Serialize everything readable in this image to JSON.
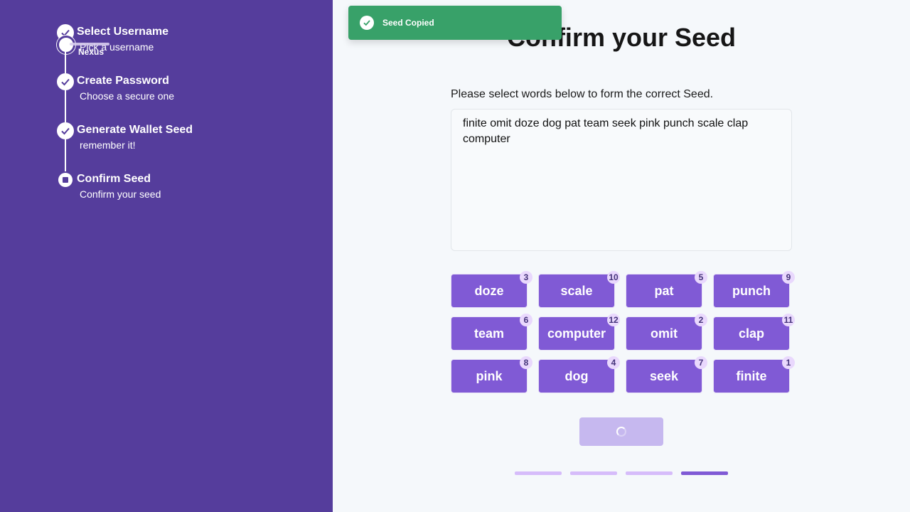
{
  "app": {
    "name": "Nexus"
  },
  "steps": [
    {
      "title": "Select Username",
      "subtitle": "Pick a username",
      "status": "complete"
    },
    {
      "title": "Create Password",
      "subtitle": "Choose a secure one",
      "status": "complete"
    },
    {
      "title": "Generate Wallet Seed",
      "subtitle": "remember it!",
      "status": "complete"
    },
    {
      "title": "Confirm Seed",
      "subtitle": "Confirm your seed",
      "status": "current"
    }
  ],
  "toast": {
    "message": "Seed Copied",
    "icon": "check-icon",
    "color": "#38a169"
  },
  "main": {
    "title": "Confirm your Seed",
    "instructions": "Please select words below to form the correct Seed.",
    "selected_seed": "finite omit doze dog pat team seek pink punch scale clap computer",
    "words": [
      {
        "word": "doze",
        "order": "3"
      },
      {
        "word": "scale",
        "order": "10"
      },
      {
        "word": "pat",
        "order": "5"
      },
      {
        "word": "punch",
        "order": "9"
      },
      {
        "word": "team",
        "order": "6"
      },
      {
        "word": "computer",
        "order": "12"
      },
      {
        "word": "omit",
        "order": "2"
      },
      {
        "word": "clap",
        "order": "11"
      },
      {
        "word": "pink",
        "order": "8"
      },
      {
        "word": "dog",
        "order": "4"
      },
      {
        "word": "seek",
        "order": "7"
      },
      {
        "word": "finite",
        "order": "1"
      }
    ],
    "submit_button": {
      "state": "loading"
    }
  },
  "progress": {
    "total_steps": 4,
    "current_step": 4
  },
  "colors": {
    "sidebar": "#553d9c",
    "accent": "#805ad5",
    "badge": "#e9d8fd",
    "success": "#38a169"
  }
}
